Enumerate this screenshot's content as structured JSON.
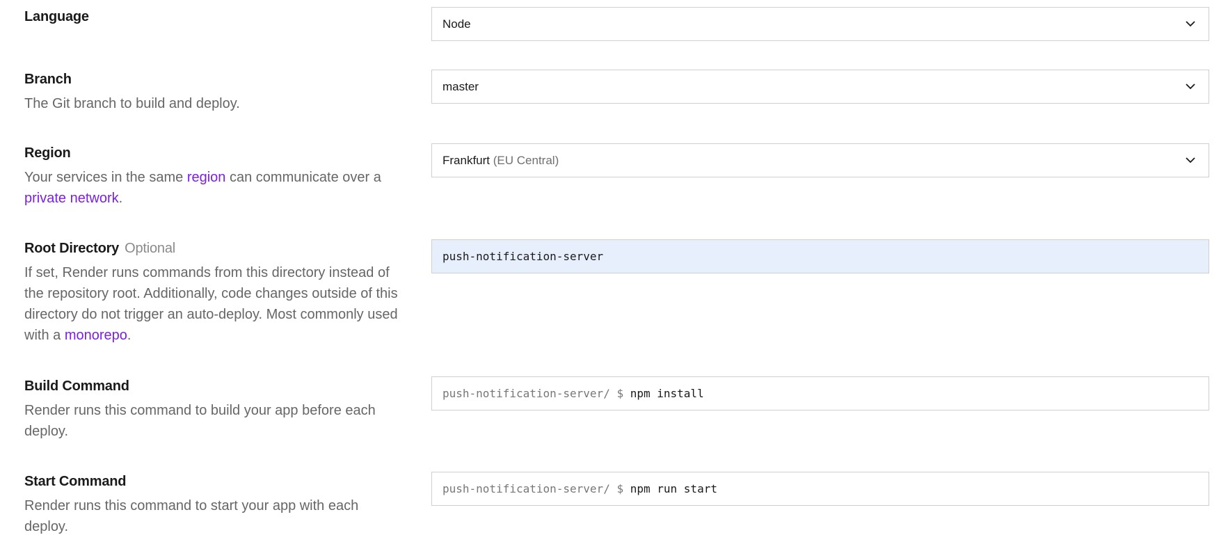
{
  "language": {
    "title": "Language",
    "selected": "Node"
  },
  "branch": {
    "title": "Branch",
    "help": "The Git branch to build and deploy.",
    "selected": "master"
  },
  "region": {
    "title": "Region",
    "help_pre": "Your services in the same ",
    "help_link1": "region",
    "help_mid": " can communicate over a ",
    "help_link2": "private network",
    "help_post": ".",
    "selected_main": "Frankfurt",
    "selected_sub": "(EU Central)"
  },
  "root_directory": {
    "title": "Root Directory",
    "optional": "Optional",
    "help_pre": "If set, Render runs commands from this directory instead of the repository root. Additionally, code changes outside of this directory do not trigger an auto-deploy. Most commonly used with a ",
    "help_link": "monorepo",
    "help_post": ".",
    "value": "push-notification-server"
  },
  "build_command": {
    "title": "Build Command",
    "help": "Render runs this command to build your app before each deploy.",
    "prefix": "push-notification-server/ $",
    "value": "npm install"
  },
  "start_command": {
    "title": "Start Command",
    "help": "Render runs this command to start your app with each deploy.",
    "prefix": "push-notification-server/ $",
    "value": "npm run start"
  }
}
